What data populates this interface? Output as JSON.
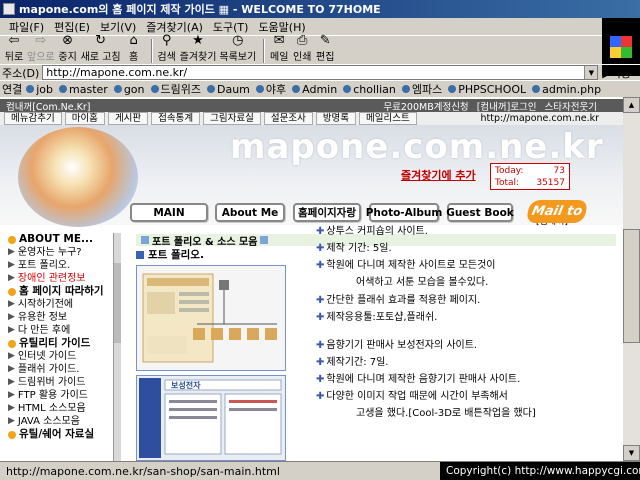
{
  "window": {
    "title": "mapone.com의 홈 페이지 제작 가이드 ▦ - WELCOME TO 77HOME"
  },
  "menu": [
    "파일(F)",
    "편집(E)",
    "보기(V)",
    "즐겨찾기(A)",
    "도구(T)",
    "도움말(H)"
  ],
  "toolbar": [
    {
      "label": "뒤로",
      "icon": "back-icon",
      "disabled": false
    },
    {
      "label": "앞으로",
      "icon": "forward-icon",
      "disabled": true
    },
    {
      "label": "중지",
      "icon": "stop-icon",
      "disabled": false
    },
    {
      "label": "새로 고침",
      "icon": "refresh-icon",
      "disabled": false
    },
    {
      "label": "홈",
      "icon": "home-icon",
      "disabled": false
    },
    {
      "label": "검색",
      "icon": "search-icon",
      "disabled": false
    },
    {
      "label": "즐겨찾기",
      "icon": "favorites-icon",
      "disabled": false
    },
    {
      "label": "목록보기",
      "icon": "history-icon",
      "disabled": false
    },
    {
      "label": "메일",
      "icon": "mail-icon",
      "disabled": false
    },
    {
      "label": "인쇄",
      "icon": "print-icon",
      "disabled": false
    },
    {
      "label": "편집",
      "icon": "edit-icon",
      "disabled": false
    }
  ],
  "address": {
    "label": "주소(D)",
    "url": "http://mapone.com.ne.kr/",
    "go": "이동"
  },
  "links": {
    "label": "연결",
    "items": [
      "job",
      "master",
      "gon",
      "드림위즈",
      "Daum",
      "야후",
      "Admin",
      "chollian",
      "엠파스",
      "PHPSCHOOL",
      "admin.php"
    ]
  },
  "site": {
    "top_left": "컴내꺼[Com.Ne.Kr]",
    "top_right": [
      "무료200MB계정신청",
      "[컴내꺼]로그인",
      "스타자전웃기"
    ],
    "nav": [
      "메뉴감추기",
      "마이홈",
      "게시판",
      "접속통계",
      "그림자료실",
      "설문조사",
      "방명록",
      "메일리스트"
    ],
    "nav_url": "http://mapone.com.ne.kr",
    "big_title": "mapone.com.ne.kr",
    "fav_link": "즐겨찾기에 추가",
    "counter": {
      "today_label": "Today:",
      "today": "73",
      "total_label": "Total:",
      "total": "35157"
    },
    "counter_caption": "[컴내꺼]",
    "buttons": [
      "MAIN",
      "About Me",
      "홈페이지자랑",
      "Photo-Album",
      "Guest Book"
    ],
    "mailto": "Mail to"
  },
  "sidebar": [
    {
      "text": "ABOUT ME...",
      "type": "head"
    },
    {
      "text": "운영자는 누구?",
      "type": "item"
    },
    {
      "text": "포트 폴리오.",
      "type": "item"
    },
    {
      "text": "장애인 관련정보",
      "type": "hl"
    },
    {
      "text": "홈 페이지 따라하기",
      "type": "head"
    },
    {
      "text": "시작하기전에",
      "type": "item"
    },
    {
      "text": "유용한 정보",
      "type": "item"
    },
    {
      "text": "다 만든 후에",
      "type": "item"
    },
    {
      "text": "유틸리티 가이드",
      "type": "head"
    },
    {
      "text": "인터넷 가이드",
      "type": "item"
    },
    {
      "text": "플래쉬 가이드.",
      "type": "item"
    },
    {
      "text": "드림위버 가이드",
      "type": "item"
    },
    {
      "text": "FTP 활용 가이드",
      "type": "item"
    },
    {
      "text": "HTML 소스모음",
      "type": "item"
    },
    {
      "text": "JAVA 소스모음",
      "type": "item"
    },
    {
      "text": "유틸/쉐어 자료실",
      "type": "head"
    }
  ],
  "content": {
    "section_title": "포트 폴리오 & 소스 모음",
    "sub_title": "포트 폴리오.",
    "desc": [
      {
        "text": "상투스 커피숍의 사이트.",
        "bullet": true
      },
      {
        "text": "제작 기간: 5일.",
        "bullet": true
      },
      {
        "text": "학원에 다니며 제작한 사이트로 모든것이",
        "bullet": true
      },
      {
        "text": "어색하고 서툰 모습을 볼수있다.",
        "bullet": false
      },
      {
        "text": "간단한 플래쉬 효과를 적용한 페이지.",
        "bullet": true
      },
      {
        "text": "제작응용툴:포토샵,플래쉬.",
        "bullet": true
      },
      {
        "text": "음향기기 판매사 보성전자의 사이트.",
        "bullet": true
      },
      {
        "text": "제작기간: 7일.",
        "bullet": true
      },
      {
        "text": "학원에 다니며 제작한 음향기기 판매사 사이트.",
        "bullet": true
      },
      {
        "text": "다양한 이미지 작업 때문에 시간이 부족해서",
        "bullet": true
      },
      {
        "text": "고생을 했다.[Cool-3D로 배튼작업을 했다]",
        "bullet": false
      }
    ],
    "thumb2_title": "보성전자"
  },
  "status": {
    "url": "http://mapone.com.ne.kr/san-shop/san-main.html",
    "copyright": "Copyright(c) http://www.happycgi.com"
  }
}
